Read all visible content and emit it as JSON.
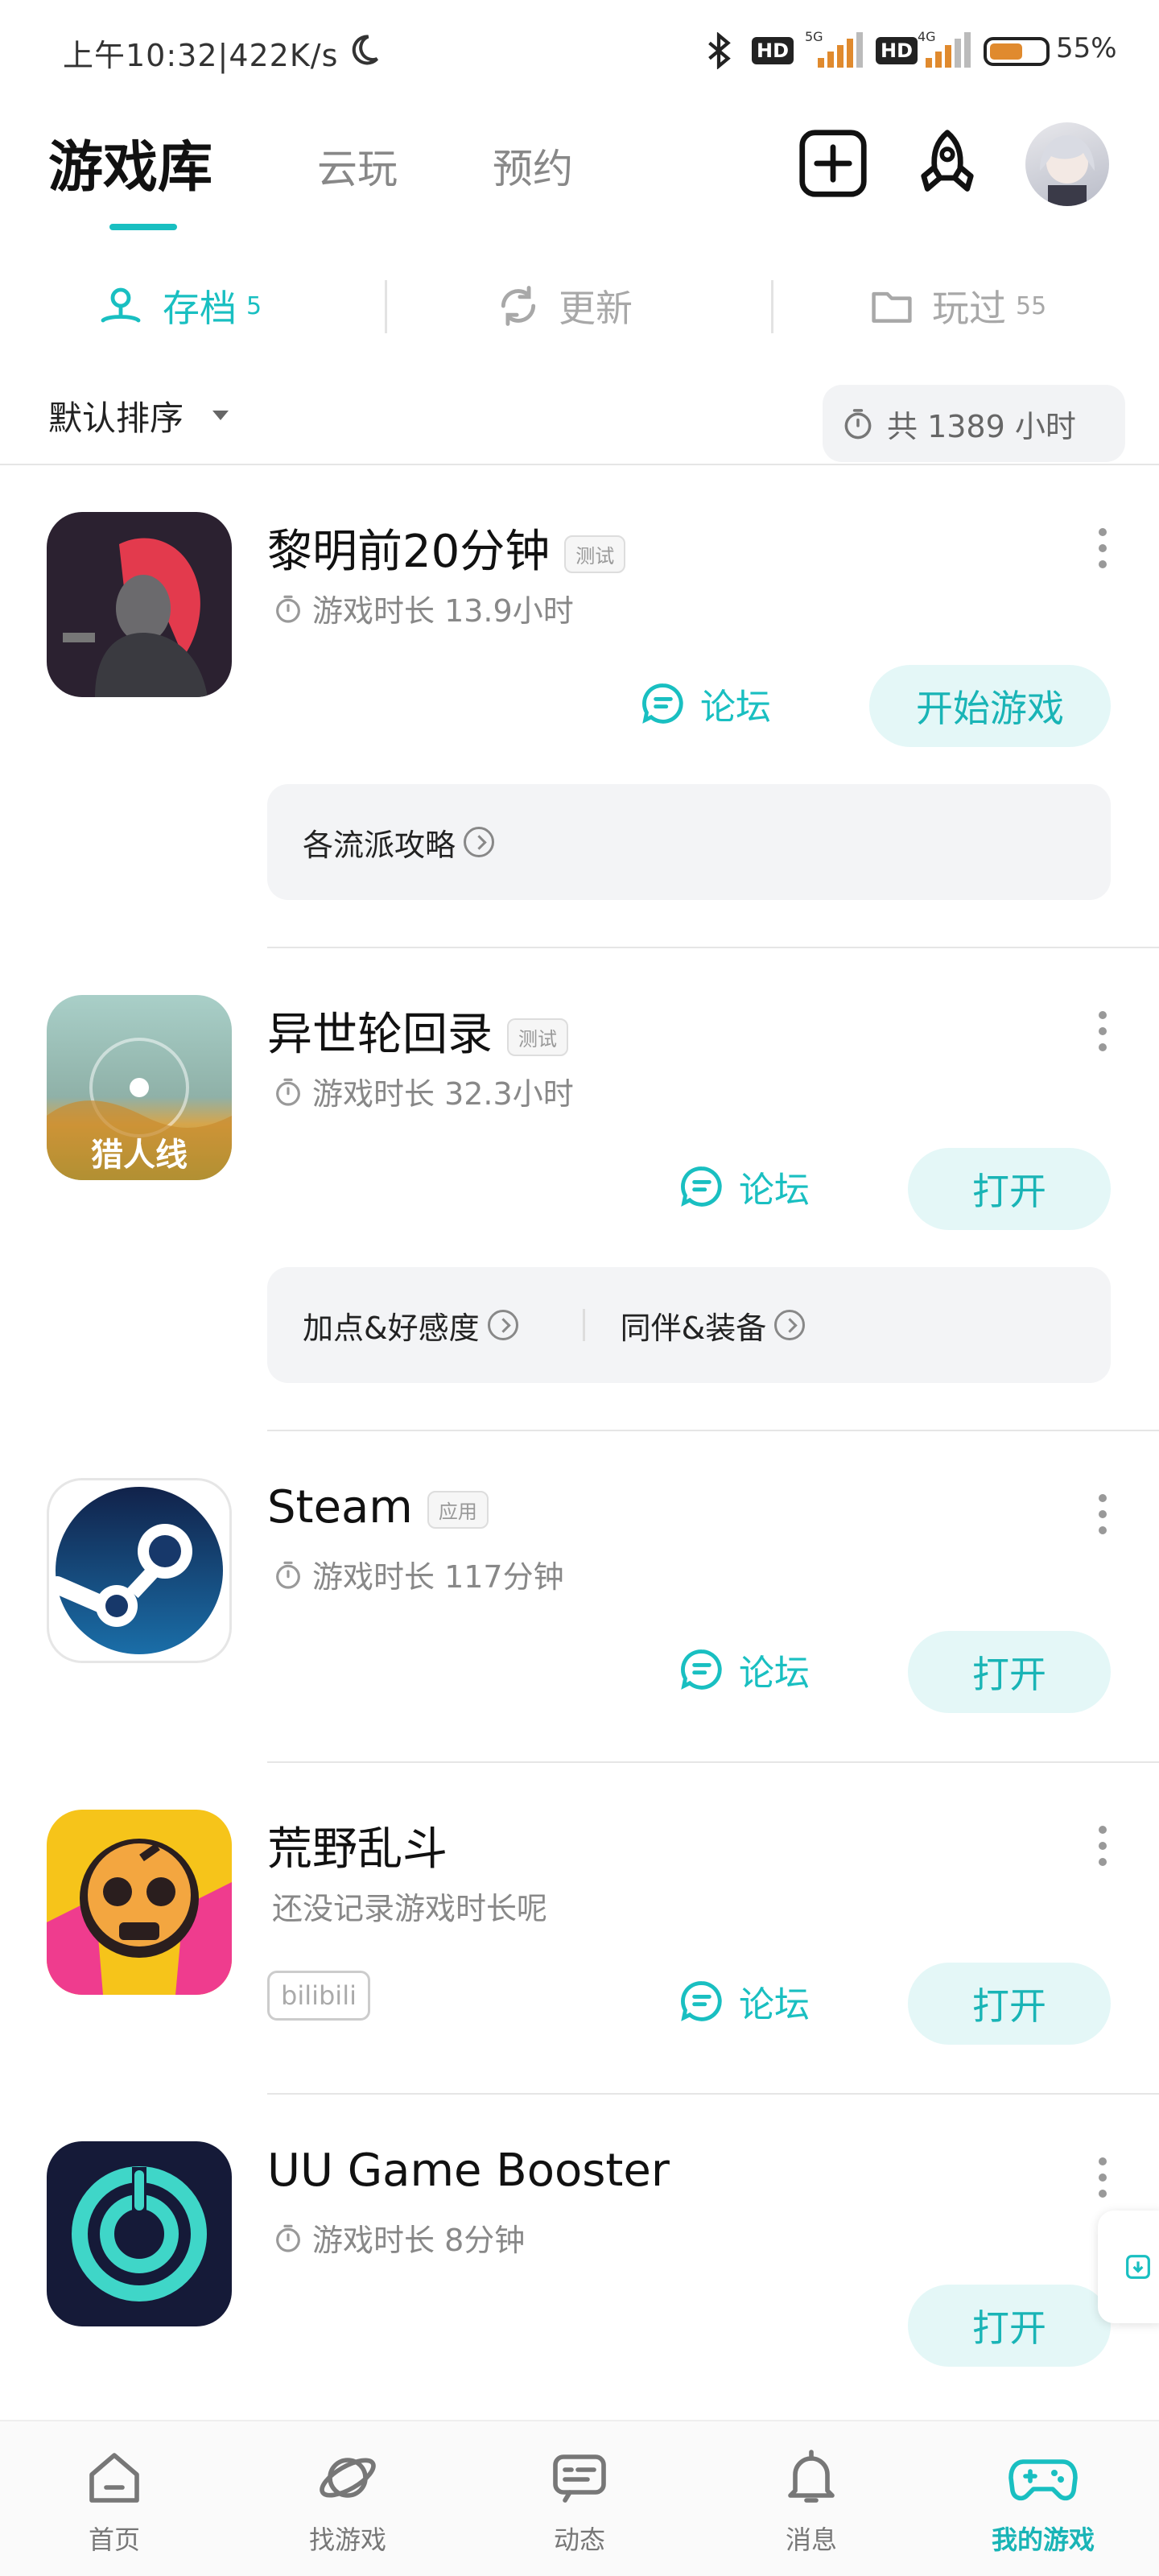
{
  "status_bar": {
    "time_speed": "上午10:32|422K/s",
    "hd1": "HD",
    "net1": "5G",
    "hd2": "HD",
    "net2": "4G",
    "battery": "55%"
  },
  "header": {
    "tabs": [
      "游戏库",
      "云玩",
      "预约"
    ]
  },
  "segments": [
    {
      "label": "存档",
      "count": "5"
    },
    {
      "label": "更新",
      "count": ""
    },
    {
      "label": "玩过",
      "count": "55"
    }
  ],
  "sort": {
    "label": "默认排序",
    "total": "共 1389 小时"
  },
  "games": [
    {
      "title": "黎明前20分钟",
      "tag": "测试",
      "playtime": "游戏时长 13.9小时",
      "forum": "论坛",
      "primary": "开始游戏",
      "guides": [
        "各流派攻略"
      ]
    },
    {
      "title": "异世轮回录",
      "tag": "测试",
      "playtime": "游戏时长 32.3小时",
      "forum": "论坛",
      "primary": "打开",
      "guides": [
        "加点&好感度",
        "同伴&装备"
      ],
      "icon_caption": "猎人线"
    },
    {
      "title": "Steam",
      "tag": "应用",
      "playtime": "游戏时长 117分钟",
      "forum": "论坛",
      "primary": "打开"
    },
    {
      "title": "荒野乱斗",
      "playtime": "还没记录游戏时长呢",
      "badge": "bilibili",
      "forum": "论坛",
      "primary": "打开"
    },
    {
      "title": "UU Game Booster",
      "playtime": "游戏时长 8分钟",
      "primary": "打开"
    }
  ],
  "bottom_nav": [
    {
      "label": "首页",
      "icon": "home-icon"
    },
    {
      "label": "找游戏",
      "icon": "planet-icon"
    },
    {
      "label": "动态",
      "icon": "message-card-icon"
    },
    {
      "label": "消息",
      "icon": "bell-icon"
    },
    {
      "label": "我的游戏",
      "icon": "gamepad-icon"
    }
  ],
  "colors": {
    "accent": "#19bfc1",
    "accent_bg": "#e4f7f7",
    "muted": "#888888"
  }
}
